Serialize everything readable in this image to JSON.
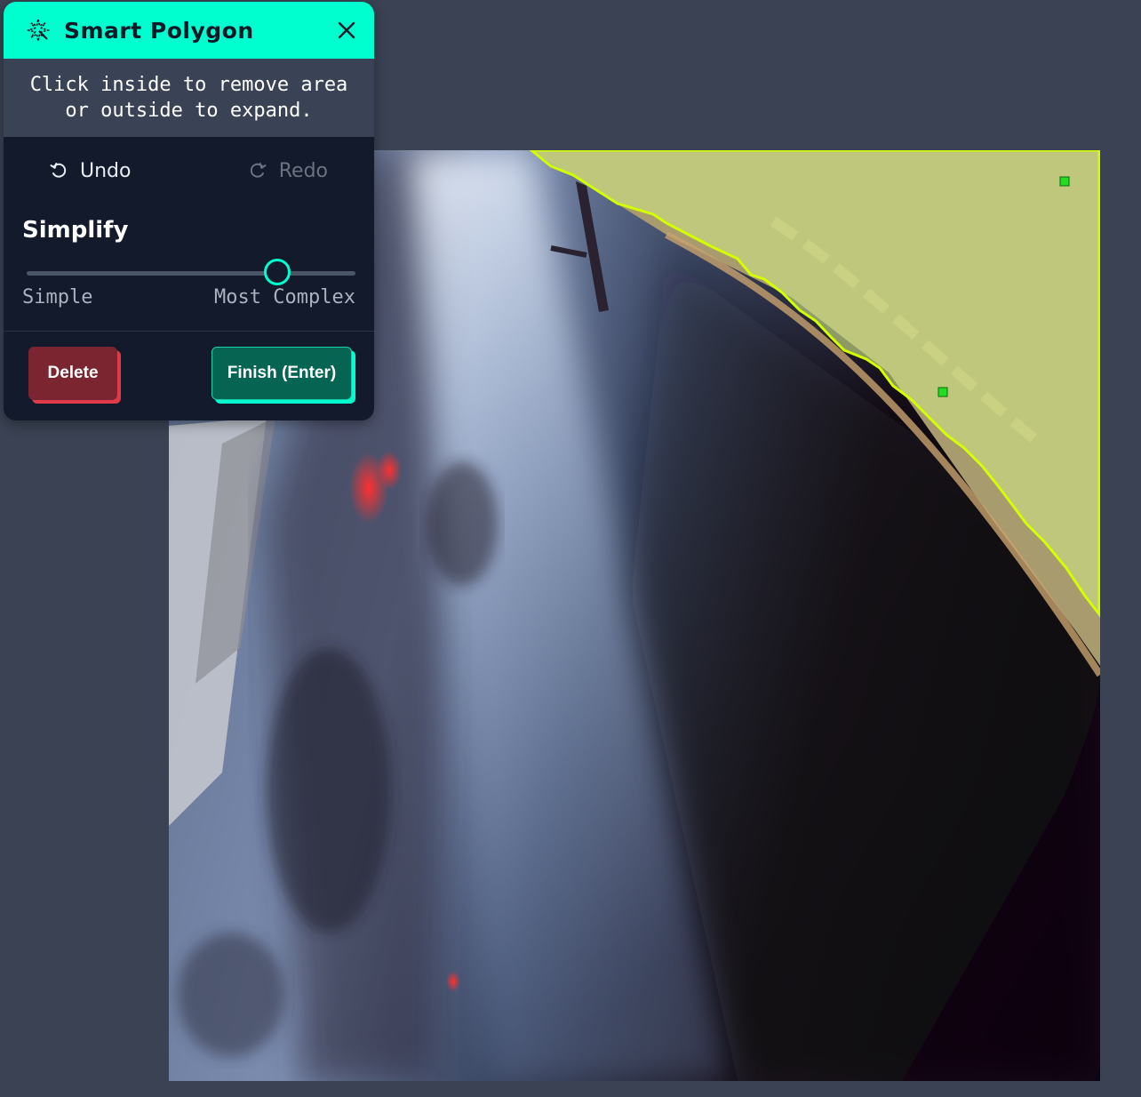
{
  "panel": {
    "title": "Smart Polygon",
    "title_icon": "magic-wand-sparkle-icon",
    "close_icon": "close-icon",
    "instructions": "Click inside to remove area\nor outside to expand.",
    "undo_label": "Undo",
    "redo_label": "Redo",
    "undo_icon": "undo-icon",
    "redo_icon": "redo-icon",
    "simplify": {
      "title": "Simplify",
      "min_label": "Simple",
      "max_label": "Most Complex",
      "value": 0.77
    },
    "delete_label": "Delete",
    "finish_label": "Finish (Enter)"
  },
  "colors": {
    "header_accent": "#00ffce",
    "polygon_outline": "#d4ff00",
    "polygon_fill": "#b8c987",
    "vertex": "#22dd22",
    "delete": "#7b2530",
    "finish": "#066453"
  }
}
